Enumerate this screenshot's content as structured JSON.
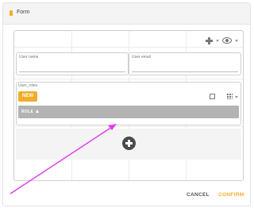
{
  "header": {
    "title": "Form"
  },
  "form": {
    "user_name_label": "User name",
    "user_email_label": "User email",
    "user_roles_label": "User_roles",
    "new_button_label": "NEW",
    "role_column_label": "ROLE"
  },
  "footer": {
    "cancel_label": "CANCEL",
    "confirm_label": "CONFIRM"
  },
  "colors": {
    "accent": "#f0ad2b",
    "grid_header": "#b3b3b3",
    "annotation_arrow": "#e040e8"
  },
  "icons": [
    "form-icon",
    "add-icon",
    "eye-icon",
    "fullscreen-icon",
    "columns-icon",
    "sort-icon",
    "add-circle-icon"
  ]
}
